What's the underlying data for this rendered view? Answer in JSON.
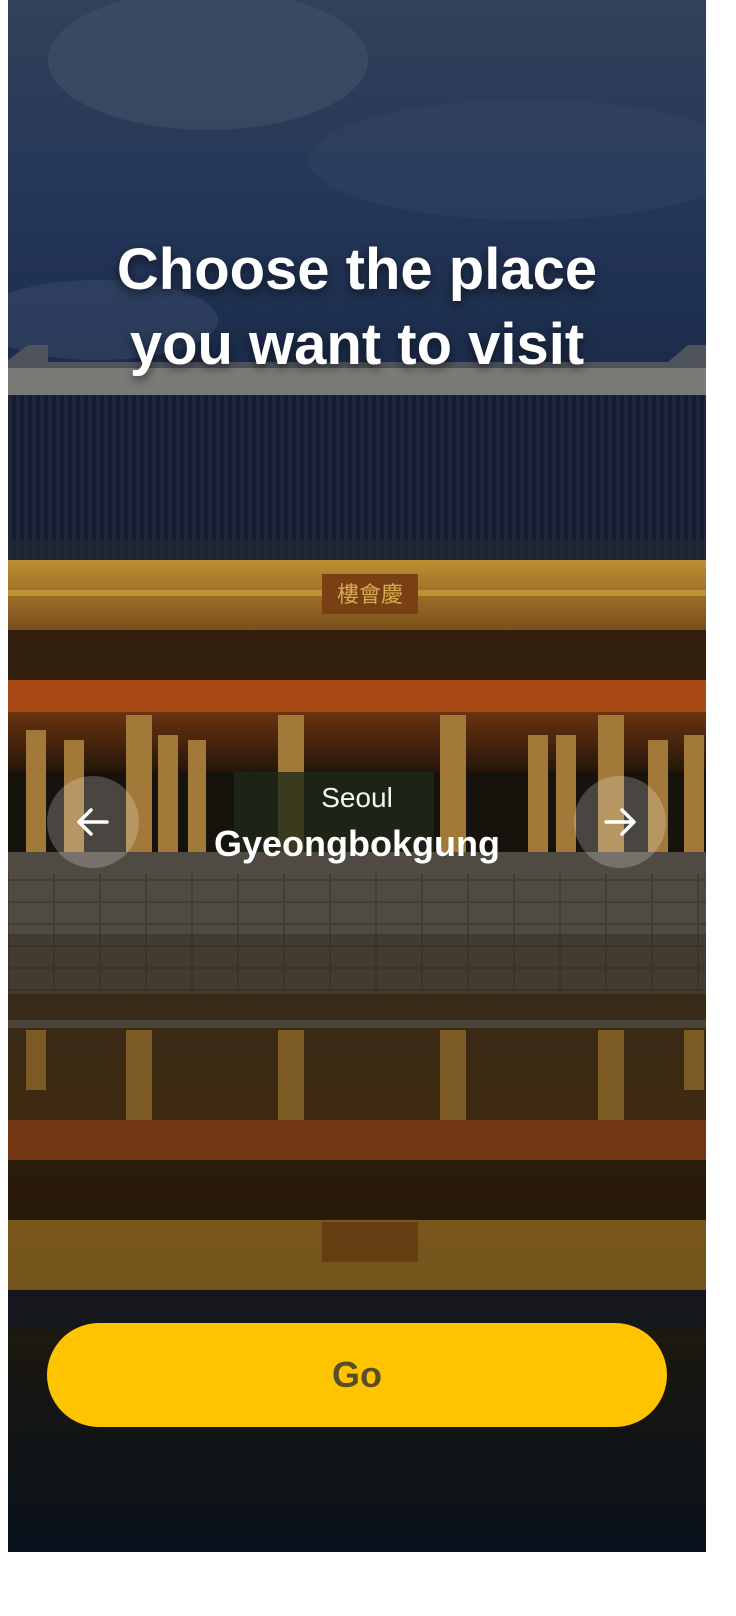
{
  "header": {
    "title_line1": "Choose the place",
    "title_line2": "you want to visit"
  },
  "place": {
    "city": "Seoul",
    "name": "Gyeongbokgung"
  },
  "nav": {
    "prev_icon": "arrow-left-icon",
    "next_icon": "arrow-right-icon"
  },
  "action": {
    "go_label": "Go"
  },
  "colors": {
    "accent": "#ffc400",
    "button_text": "#5a4d2a",
    "text": "#ffffff"
  }
}
